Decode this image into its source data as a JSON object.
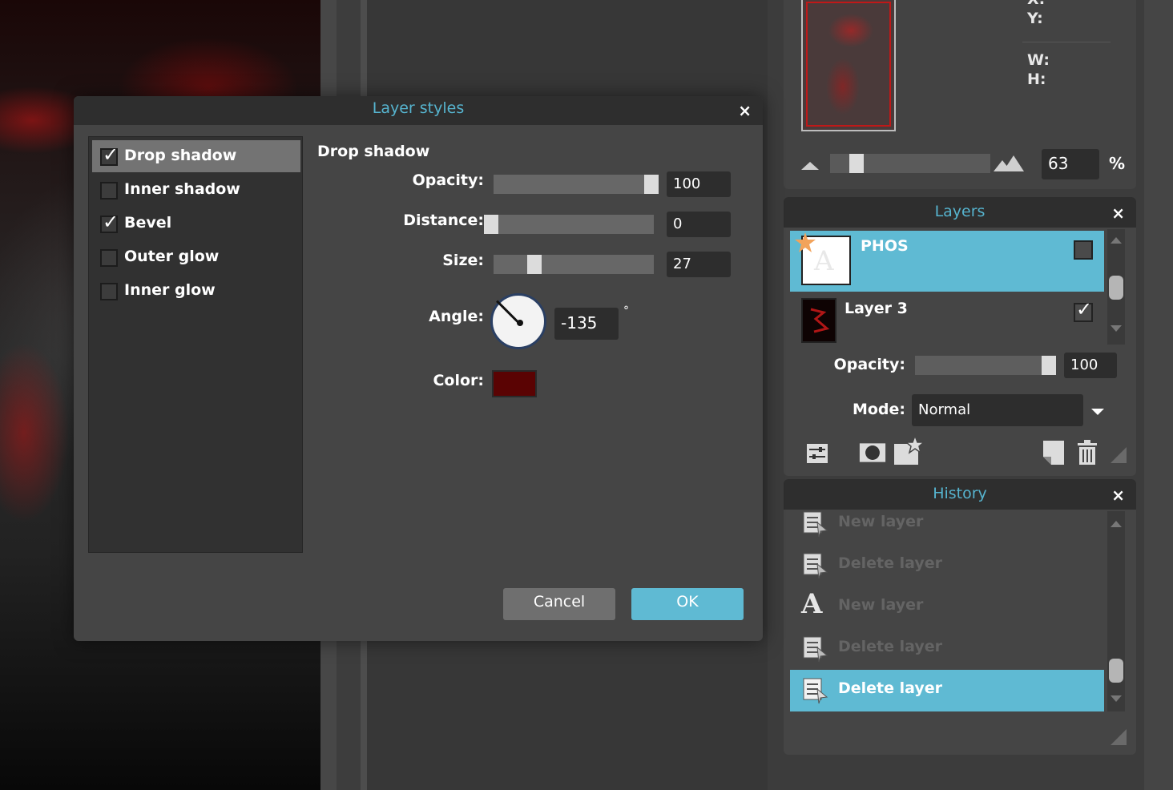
{
  "navigator": {
    "x_label": "X:",
    "y_label": "Y:",
    "w_label": "W:",
    "h_label": "H:",
    "zoom_value": "63",
    "zoom_unit": "%"
  },
  "layers": {
    "title": "Layers",
    "close": "×",
    "items": [
      {
        "name": "PHOS",
        "selected": true,
        "visible": false
      },
      {
        "name": "Layer 3",
        "selected": false,
        "visible": true
      }
    ],
    "opacity_label": "Opacity:",
    "opacity_value": "100",
    "mode_label": "Mode:",
    "mode_value": "Normal",
    "tools": [
      "adjustments-icon",
      "mask-icon",
      "new-layer-effects-icon",
      "new-layer-icon",
      "trash-icon"
    ]
  },
  "history": {
    "title": "History",
    "close": "×",
    "items": [
      {
        "label": "New layer",
        "icon": "layer-doc-icon",
        "active": false
      },
      {
        "label": "Delete layer",
        "icon": "layer-doc-icon",
        "active": false
      },
      {
        "label": "New layer",
        "icon": "text-a-icon",
        "active": false
      },
      {
        "label": "Delete layer",
        "icon": "layer-doc-icon",
        "active": false
      },
      {
        "label": "Delete layer",
        "icon": "layer-doc-icon",
        "active": true
      }
    ]
  },
  "dialog": {
    "title": "Layer styles",
    "close": "×",
    "styles": [
      {
        "label": "Drop shadow",
        "checked": true,
        "selected": true
      },
      {
        "label": "Inner shadow",
        "checked": false,
        "selected": false
      },
      {
        "label": "Bevel",
        "checked": true,
        "selected": false
      },
      {
        "label": "Outer glow",
        "checked": false,
        "selected": false
      },
      {
        "label": "Inner glow",
        "checked": false,
        "selected": false
      }
    ],
    "section_title": "Drop shadow",
    "opacity_label": "Opacity:",
    "opacity_value": "100",
    "distance_label": "Distance:",
    "distance_value": "0",
    "size_label": "Size:",
    "size_value": "27",
    "angle_label": "Angle:",
    "angle_value": "-135",
    "angle_unit": "°",
    "color_label": "Color:",
    "color_hex": "#5a0303",
    "cancel_label": "Cancel",
    "ok_label": "OK"
  },
  "colors": {
    "accent": "#56b4cf",
    "selection": "#5fbad3"
  }
}
